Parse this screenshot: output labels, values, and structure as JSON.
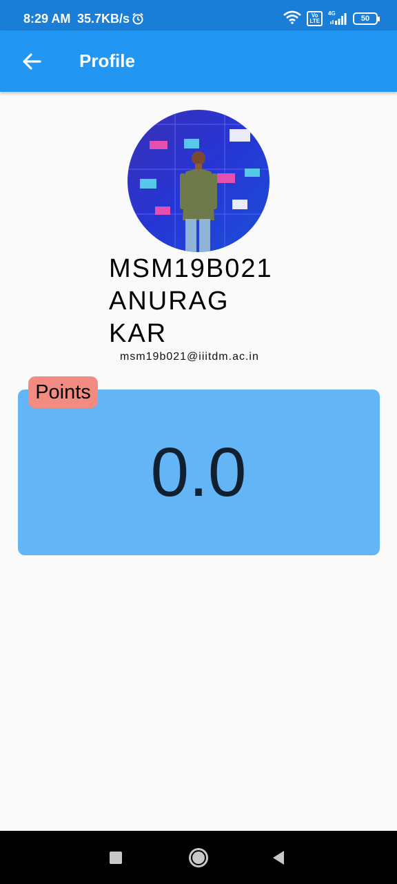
{
  "status_bar": {
    "time": "8:29 AM",
    "network_speed": "35.7KB/s",
    "volte_line1": "Vo",
    "volte_line2": "LTE",
    "network_type": "4G",
    "battery": "50"
  },
  "app_bar": {
    "title": "Profile",
    "back_icon": "arrow-back-icon"
  },
  "profile": {
    "name_line1": "MSM19B021",
    "name_line2": "ANURAG",
    "name_line3": "KAR",
    "email": "msm19b021@iiitdm.ac.in"
  },
  "points": {
    "label": "Points",
    "value": "0.0"
  },
  "colors": {
    "status_bar": "#1b7ed6",
    "app_bar": "#2196f3",
    "points_card": "#64b5f6",
    "points_chip": "#f28b82",
    "background": "#fafafa"
  },
  "nav_bar": {
    "icons": [
      "recents-icon",
      "home-icon",
      "back-icon"
    ]
  }
}
